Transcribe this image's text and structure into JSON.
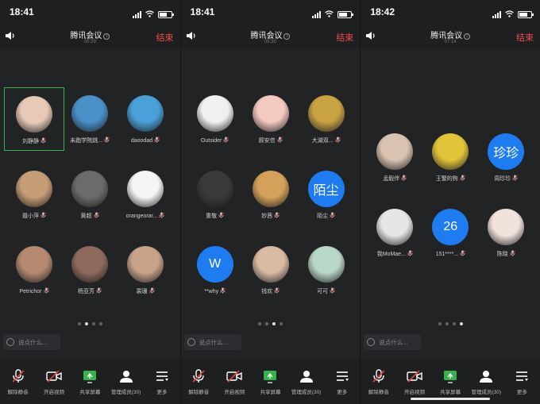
{
  "screens": [
    {
      "status_time": "18:41",
      "title": "腾讯会议",
      "duration": "05:29",
      "end_label": "结束",
      "participants": [
        {
          "name": "刘静静",
          "avatar": "girl-illustration-avatar",
          "color": "#e7c9b6",
          "active": true
        },
        {
          "name": "未跑学院跳...",
          "avatar": "pineapple-cartoon-avatar",
          "color": "#4a91c9"
        },
        {
          "name": "daoodad",
          "avatar": "sunset-landscape-avatar",
          "color": "#4aa0d8"
        },
        {
          "name": "聂小萍",
          "avatar": "blonde-woman-avatar",
          "color": "#c59d76"
        },
        {
          "name": "黄超",
          "avatar": "hippo-avatar",
          "color": "#6b6b6b"
        },
        {
          "name": "orangeorar...",
          "avatar": "egg-avatar",
          "color": "#f5f5f5"
        },
        {
          "name": "Petrichor",
          "avatar": "girl-portrait-avatar",
          "color": "#b58a70"
        },
        {
          "name": "杨亚芳",
          "avatar": "flower-girl-avatar",
          "color": "#8d6a5c"
        },
        {
          "name": "裴珊",
          "avatar": "girl-selfie-avatar",
          "color": "#c9a28a"
        }
      ],
      "dots": [
        false,
        true,
        false,
        false
      ]
    },
    {
      "status_time": "18:41",
      "title": "腾讯会议",
      "duration": "05:30",
      "end_label": "结束",
      "participants": [
        {
          "name": "Outsider",
          "avatar": "cartoon-cat-avatar",
          "color": "#f0f0f0"
        },
        {
          "name": "顾安信",
          "avatar": "cartoon-girl-avatar",
          "color": "#f3c9c0"
        },
        {
          "name": "大湖双...",
          "avatar": "pearl-earring-avatar",
          "color": "#c9a244"
        },
        {
          "name": "重敬",
          "avatar": "night-city-avatar",
          "color": "#3a3a3a"
        },
        {
          "name": "妙茜",
          "avatar": "bread-avatar",
          "color": "#d3a15a"
        },
        {
          "name": "陌尘",
          "avatar_text": "陌尘",
          "color": "#1f7cf0"
        },
        {
          "name": "**why",
          "avatar_text": "W",
          "color": "#1f7cf0"
        },
        {
          "name": "钱欢",
          "avatar": "girl-flowers-avatar",
          "color": "#d9bba4"
        },
        {
          "name": "可可",
          "avatar": "lotus-avatar",
          "color": "#b9d7c6"
        }
      ],
      "dots": [
        false,
        false,
        true,
        false
      ]
    },
    {
      "status_time": "18:42",
      "title": "腾讯会议",
      "duration": "07:14",
      "end_label": "结束",
      "participants": [
        {
          "name": "孟毅伴",
          "avatar": "baby-avatar",
          "color": "#d9c2b0"
        },
        {
          "name": "王警的狗",
          "avatar": "spongebob-avatar",
          "color": "#e2c43a"
        },
        {
          "name": "周珍珍",
          "avatar_text": "珍珍",
          "color": "#1f7cf0"
        },
        {
          "name": "我MoMae...",
          "avatar": "white-cat-avatar",
          "color": "#e6e6e6"
        },
        {
          "name": "151****...",
          "avatar_text": "26",
          "color": "#1f7cf0"
        },
        {
          "name": "陈晓",
          "avatar": "santa-cartoon-avatar",
          "color": "#f1e3dc"
        }
      ],
      "dots": [
        false,
        false,
        false,
        true
      ]
    }
  ],
  "chat_placeholder": "说点什么...",
  "toolbar": [
    {
      "label": "解除静音",
      "icon": "mic-muted-icon"
    },
    {
      "label": "开启视频",
      "icon": "video-off-icon"
    },
    {
      "label": "共享屏幕",
      "icon": "share-screen-icon"
    },
    {
      "label": "管理成员(30)",
      "icon": "members-icon"
    },
    {
      "label": "更多",
      "icon": "more-icon"
    }
  ],
  "colors": {
    "accent": "#1f7cf0",
    "end": "#f04b4b",
    "active_border": "#35b24a",
    "muted": "#e0433e",
    "share": "#35b24a"
  }
}
